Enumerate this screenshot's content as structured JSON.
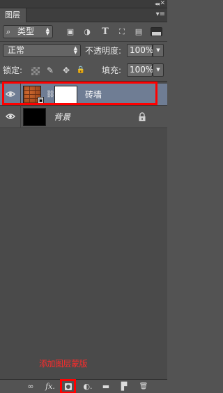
{
  "panel": {
    "tab_label": "图层",
    "collapse_glyph": "◂◂",
    "close_glyph": "✕",
    "menu_glyph": "▾≡"
  },
  "filter": {
    "kind_label": "类型",
    "search_glyph": "⌕",
    "icons": [
      "image-filter-icon",
      "adjustment-filter-icon",
      "type-filter-icon",
      "shape-filter-icon",
      "smart-object-filter-icon"
    ],
    "icon_glyphs": [
      "▣",
      "◑",
      "T",
      "⛶",
      "▤"
    ]
  },
  "blend": {
    "mode": "正常",
    "opacity_label": "不透明度:",
    "opacity_value": "100%",
    "lock_label": "锁定:",
    "fill_label": "填充:",
    "fill_value": "100%",
    "lock_glyphs": [
      "✎",
      "✥",
      "🔒"
    ]
  },
  "layers": [
    {
      "name": "砖墙",
      "selected": true,
      "visible": true,
      "has_mask": true,
      "smart_object": true
    },
    {
      "name": "背景",
      "selected": false,
      "visible": true,
      "locked": true
    }
  ],
  "annotation": {
    "text": "添加图层蒙版",
    "color": "#ff0000"
  },
  "bottom_bar": {
    "link_glyph": "∞",
    "fx_glyph": "fx.",
    "adjust_glyph": "◐.",
    "group_glyph": "▬",
    "new_glyph": "▛",
    "delete_glyph": "🗑"
  },
  "colors": {
    "panel_bg": "#535353",
    "selected_layer": "#6f7d94",
    "highlight": "#ff0000"
  }
}
